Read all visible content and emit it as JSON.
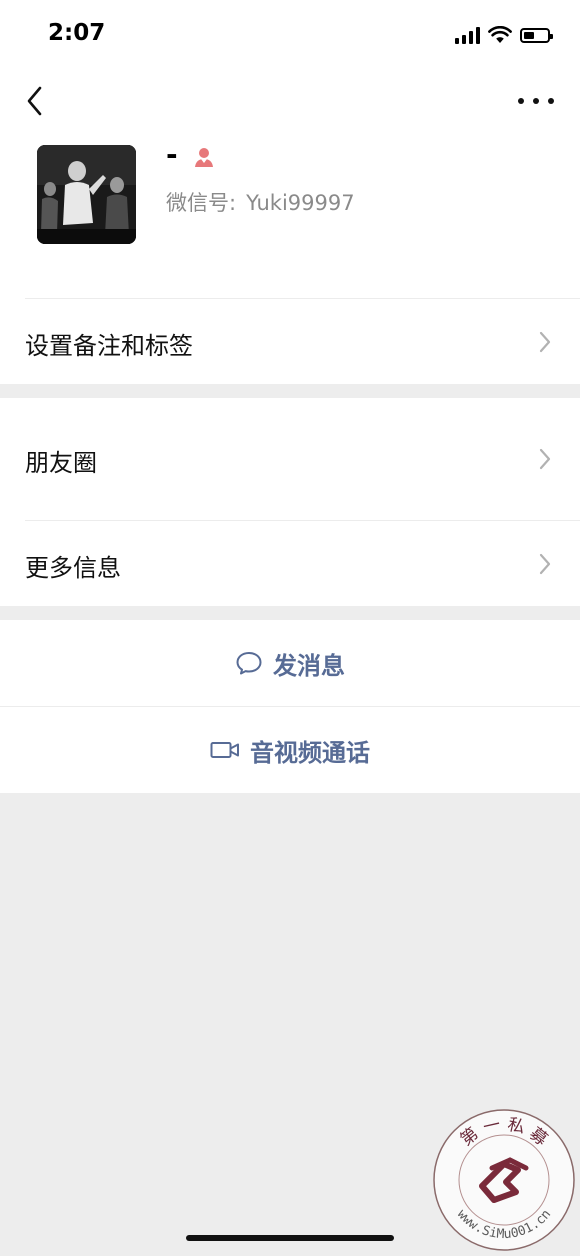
{
  "status_bar": {
    "time": "2:07"
  },
  "nav": {
    "back_icon": "chevron-left-icon",
    "more_icon": "more-dots-icon"
  },
  "profile": {
    "nickname": "-",
    "gender_icon": "female-icon",
    "gender_color": "#e7787a",
    "wechat_id_label": "微信号:",
    "wechat_id": "Yuki99997"
  },
  "menu": {
    "remark_tags": "设置备注和标签",
    "moments": "朋友圈",
    "more_info": "更多信息"
  },
  "actions": {
    "send_message": "发消息",
    "av_call": "音视频通话",
    "accent_color": "#576b95"
  },
  "watermark": {
    "text_top": "第 一 私 募",
    "text_bottom": "www.SiMu001.cn"
  }
}
